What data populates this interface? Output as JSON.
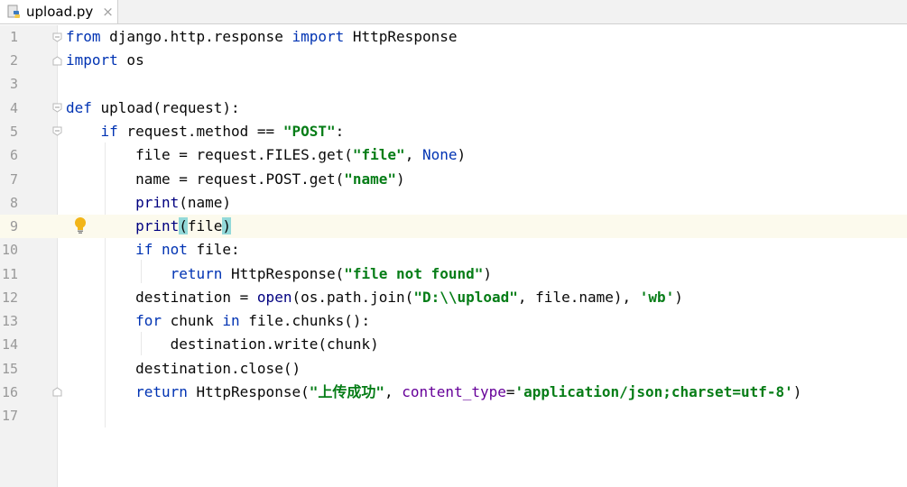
{
  "tab": {
    "filename": "upload.py",
    "close": "×"
  },
  "line_numbers": [
    "1",
    "2",
    "3",
    "4",
    "5",
    "6",
    "7",
    "8",
    "9",
    "10",
    "11",
    "12",
    "13",
    "14",
    "15",
    "16",
    "17"
  ],
  "code": {
    "l1": {
      "kw1": "from",
      "t1": " django.http.response ",
      "kw2": "import",
      "t2": " HttpResponse"
    },
    "l2": {
      "kw1": "import",
      "t1": " os"
    },
    "l4": {
      "kw1": "def",
      "t1": " upload(request):"
    },
    "l5": {
      "indent": "    ",
      "kw1": "if",
      "t1": " request.method == ",
      "s1": "\"POST\"",
      "t2": ":"
    },
    "l6": {
      "indent": "        ",
      "t1": "file = request.FILES.get(",
      "s1": "\"file\"",
      "t2": ", ",
      "kw1": "None",
      "t3": ")"
    },
    "l7": {
      "indent": "        ",
      "t1": "name = request.POST.get(",
      "s1": "\"name\"",
      "t2": ")"
    },
    "l8": {
      "indent": "        ",
      "bi1": "print",
      "t1": "(name)"
    },
    "l9": {
      "indent": "        ",
      "bi1": "print",
      "m1": "(",
      "t1": "file",
      "m2": ")"
    },
    "l10": {
      "indent": "        ",
      "kw1": "if",
      "t1": " ",
      "kw2": "not",
      "t2": " file:"
    },
    "l11": {
      "indent": "            ",
      "kw1": "return",
      "t1": " HttpResponse(",
      "s1": "\"file not found\"",
      "t2": ")"
    },
    "l12": {
      "indent": "        ",
      "t1": "destination = ",
      "bi1": "open",
      "t2": "(os.path.join(",
      "s1": "\"D:\\\\upload\"",
      "t3": ", file.name), ",
      "s2": "'wb'",
      "t4": ")"
    },
    "l13": {
      "indent": "        ",
      "kw1": "for",
      "t1": " chunk ",
      "kw2": "in",
      "t2": " file.chunks():"
    },
    "l14": {
      "indent": "            ",
      "t1": "destination.write(chunk)"
    },
    "l15": {
      "indent": "        ",
      "t1": "destination.close()"
    },
    "l16": {
      "indent": "        ",
      "kw1": "return",
      "t1": " HttpResponse(",
      "s1": "\"上传成功\"",
      "t2": ", ",
      "p1": "content_type",
      "t3": "=",
      "s2": "'application/json;charset=utf-8'",
      "t4": ")"
    }
  },
  "colors": {
    "keyword": "#0033b3",
    "string": "#067d17",
    "param": "#660099",
    "current_line": "#fcfaed",
    "brace_match": "#93d9d9"
  },
  "icons": {
    "file": "python-file-icon",
    "intention": "lightbulb-icon"
  }
}
